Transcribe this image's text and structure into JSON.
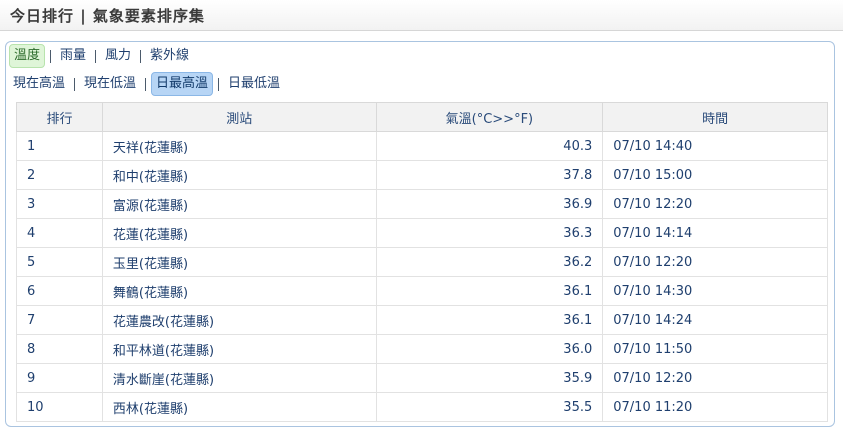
{
  "header": {
    "title": "今日排行 | 氣象要素排序集"
  },
  "element_tabs": [
    {
      "label": "溫度",
      "active": true
    },
    {
      "label": "雨量",
      "active": false
    },
    {
      "label": "風力",
      "active": false
    },
    {
      "label": "紫外線",
      "active": false
    }
  ],
  "temp_tabs": [
    {
      "label": "現在高溫",
      "active": false
    },
    {
      "label": "現在低溫",
      "active": false
    },
    {
      "label": "日最高溫",
      "active": true
    },
    {
      "label": "日最低溫",
      "active": false
    }
  ],
  "table": {
    "headers": [
      "排行",
      "測站",
      "氣溫(°C>>°F)",
      "時間"
    ],
    "rows": [
      {
        "rank": "1",
        "station": "天祥(花蓮縣)",
        "temp": "40.3",
        "time": "07/10 14:40"
      },
      {
        "rank": "2",
        "station": "和中(花蓮縣)",
        "temp": "37.8",
        "time": "07/10 15:00"
      },
      {
        "rank": "3",
        "station": "富源(花蓮縣)",
        "temp": "36.9",
        "time": "07/10 12:20"
      },
      {
        "rank": "4",
        "station": "花蓮(花蓮縣)",
        "temp": "36.3",
        "time": "07/10 14:14"
      },
      {
        "rank": "5",
        "station": "玉里(花蓮縣)",
        "temp": "36.2",
        "time": "07/10 12:20"
      },
      {
        "rank": "6",
        "station": "舞鶴(花蓮縣)",
        "temp": "36.1",
        "time": "07/10 14:30"
      },
      {
        "rank": "7",
        "station": "花蓮農改(花蓮縣)",
        "temp": "36.1",
        "time": "07/10 14:24"
      },
      {
        "rank": "8",
        "station": "和平林道(花蓮縣)",
        "temp": "36.0",
        "time": "07/10 11:50"
      },
      {
        "rank": "9",
        "station": "清水斷崖(花蓮縣)",
        "temp": "35.9",
        "time": "07/10 12:20"
      },
      {
        "rank": "10",
        "station": "西林(花蓮縣)",
        "temp": "35.5",
        "time": "07/10 11:20"
      }
    ]
  }
}
